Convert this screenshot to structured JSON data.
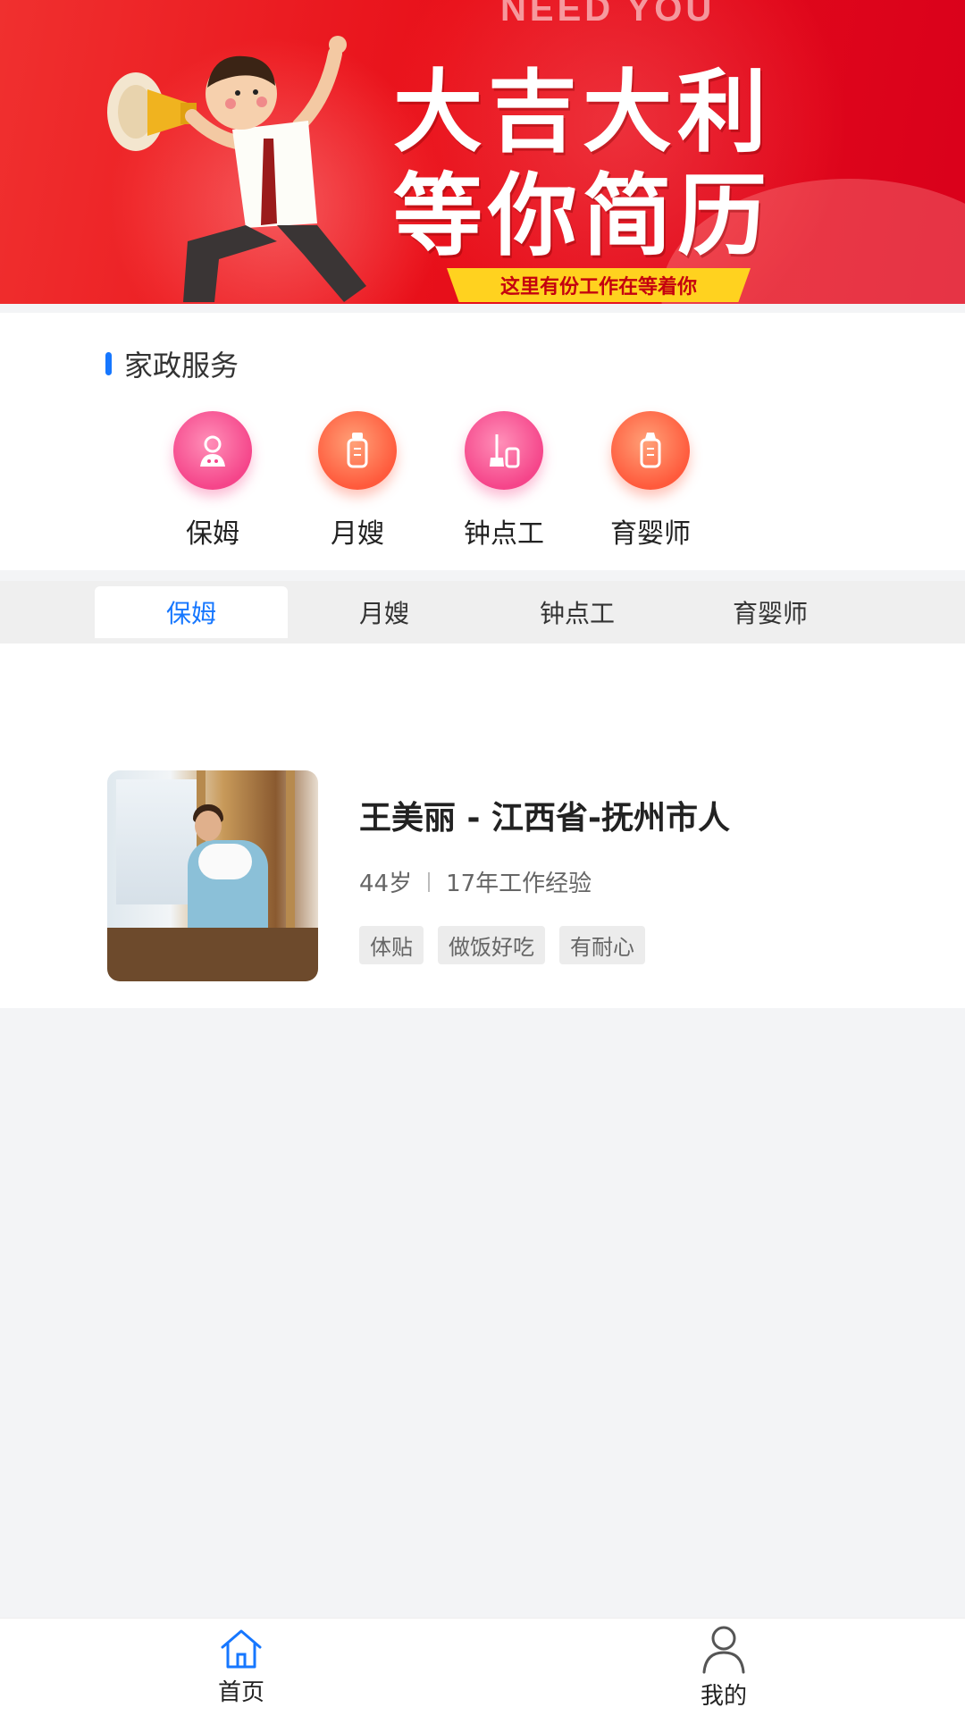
{
  "banner": {
    "top_text": "NEED YOU",
    "headline_line1": "大吉大利",
    "headline_line2": "等你简历",
    "ribbon_text": "这里有份工作在等着你"
  },
  "section": {
    "title": "家政服务"
  },
  "categories": [
    {
      "label": "保姆",
      "icon": "nanny-icon",
      "color": "#f5458a"
    },
    {
      "label": "月嫂",
      "icon": "bottle-icon",
      "color": "#ff5a3c"
    },
    {
      "label": "钟点工",
      "icon": "mop-icon",
      "color": "#f5458a"
    },
    {
      "label": "育婴师",
      "icon": "baby-bottle-icon",
      "color": "#ff5a3c"
    }
  ],
  "tabs": [
    {
      "label": "保姆",
      "active": true
    },
    {
      "label": "月嫂",
      "active": false
    },
    {
      "label": "钟点工",
      "active": false
    },
    {
      "label": "育婴师",
      "active": false
    }
  ],
  "workers": [
    {
      "name": "王美丽 - 江西省-抚州市人",
      "age": "44岁",
      "experience": "17年工作经验",
      "tags": [
        "体贴",
        "做饭好吃",
        "有耐心"
      ]
    }
  ],
  "bottom_nav": [
    {
      "label": "首页",
      "icon": "home-icon",
      "active": true
    },
    {
      "label": "我的",
      "icon": "user-icon",
      "active": false
    }
  ],
  "colors": {
    "accent": "#1677ff",
    "banner_red": "#e8101a",
    "ribbon_yellow": "#ffd21f"
  }
}
